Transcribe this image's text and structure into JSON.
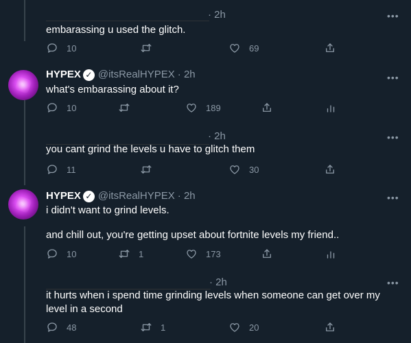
{
  "tweets": [
    {
      "time_text": "· 2h",
      "text": "embarassing u used the glitch.",
      "reply_count": "10",
      "retweet_count": "",
      "like_count": "69"
    },
    {
      "name": "HYPEX",
      "handle": "@itsRealHYPEX",
      "time_text": "· 2h",
      "text": "what's embarassing about it?",
      "reply_count": "10",
      "retweet_count": "",
      "like_count": "189"
    },
    {
      "time_text": "· 2h",
      "text": "you cant grind the levels u have to glitch them",
      "reply_count": "11",
      "retweet_count": "",
      "like_count": "30"
    },
    {
      "name": "HYPEX",
      "handle": "@itsRealHYPEX",
      "time_text": "· 2h",
      "text_line1": "i didn't want to grind levels.",
      "text_line2": "and chill out, you're getting upset about fortnite levels my friend..",
      "reply_count": "10",
      "retweet_count": "1",
      "like_count": "173"
    },
    {
      "time_text": "· 2h",
      "text": "it hurts when i spend time grinding levels when someone can get over my level in a second",
      "reply_count": "48",
      "retweet_count": "1",
      "like_count": "20"
    }
  ],
  "icons": {
    "reply": "reply-icon",
    "retweet": "retweet-icon",
    "like": "heart-icon",
    "share": "share-icon",
    "analytics": "analytics-icon",
    "more": "more-icon",
    "verified": "verified-badge-icon"
  },
  "colors": {
    "background": "#15202b",
    "secondary_text": "#8b98a5",
    "primary_text": "#ffffff"
  }
}
